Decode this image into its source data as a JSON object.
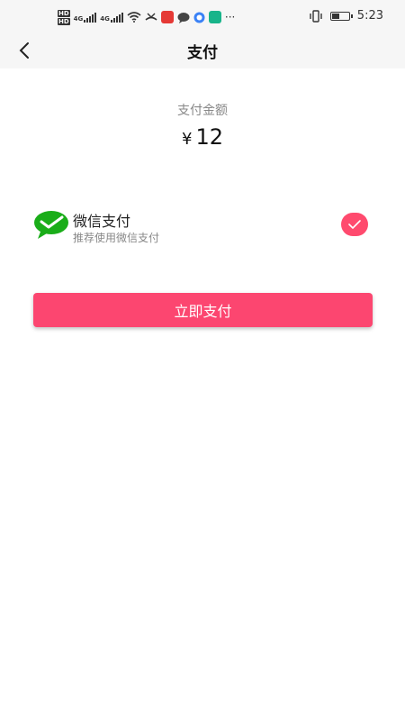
{
  "status_bar": {
    "network_1": "4G",
    "network_2": "4G",
    "time": "5:23",
    "more": "···"
  },
  "header": {
    "title": "支付"
  },
  "amount": {
    "label": "支付金额",
    "currency": "¥",
    "value": "12"
  },
  "payment_option": {
    "name": "微信支付",
    "subtitle": "推荐使用微信支付",
    "icon": "wechat-icon",
    "selected": true
  },
  "pay_button": {
    "label": "立即支付"
  },
  "colors": {
    "accent": "#fc4670",
    "wechat_green": "#1aad19"
  }
}
